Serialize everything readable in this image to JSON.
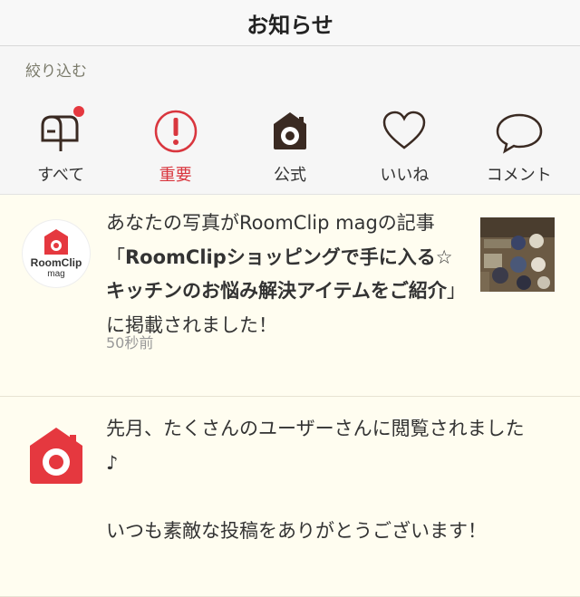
{
  "header": {
    "title": "お知らせ"
  },
  "filter": {
    "label": "絞り込む",
    "items": [
      {
        "id": "all",
        "label": "すべて",
        "icon": "mailbox-icon",
        "has_badge": true
      },
      {
        "id": "important",
        "label": "重要",
        "icon": "exclamation-circle-icon",
        "color": "#d9363e"
      },
      {
        "id": "official",
        "label": "公式",
        "icon": "house-camera-icon"
      },
      {
        "id": "likes",
        "label": "いいね",
        "icon": "heart-icon"
      },
      {
        "id": "comments",
        "label": "コメント",
        "icon": "speech-bubble-icon"
      }
    ]
  },
  "notifications": [
    {
      "avatar_text": "RoomClip",
      "avatar_subtext": "mag",
      "text_pre": "あなたの写真がRoomClip magの記事「",
      "text_bold": "RoomClipショッピングで手に入る☆キッチンのお悩み解決アイテムをご紹介",
      "text_post": "」に掲載されました！",
      "time": "50秒前"
    },
    {
      "text": "先月、たくさんのユーザーさんに閲覧されました♪\n\nいつも素敵な投稿をありがとうございます！"
    }
  ],
  "colors": {
    "accent": "#d9363e",
    "brand": "#e5383f",
    "background": "#fffdf0"
  }
}
